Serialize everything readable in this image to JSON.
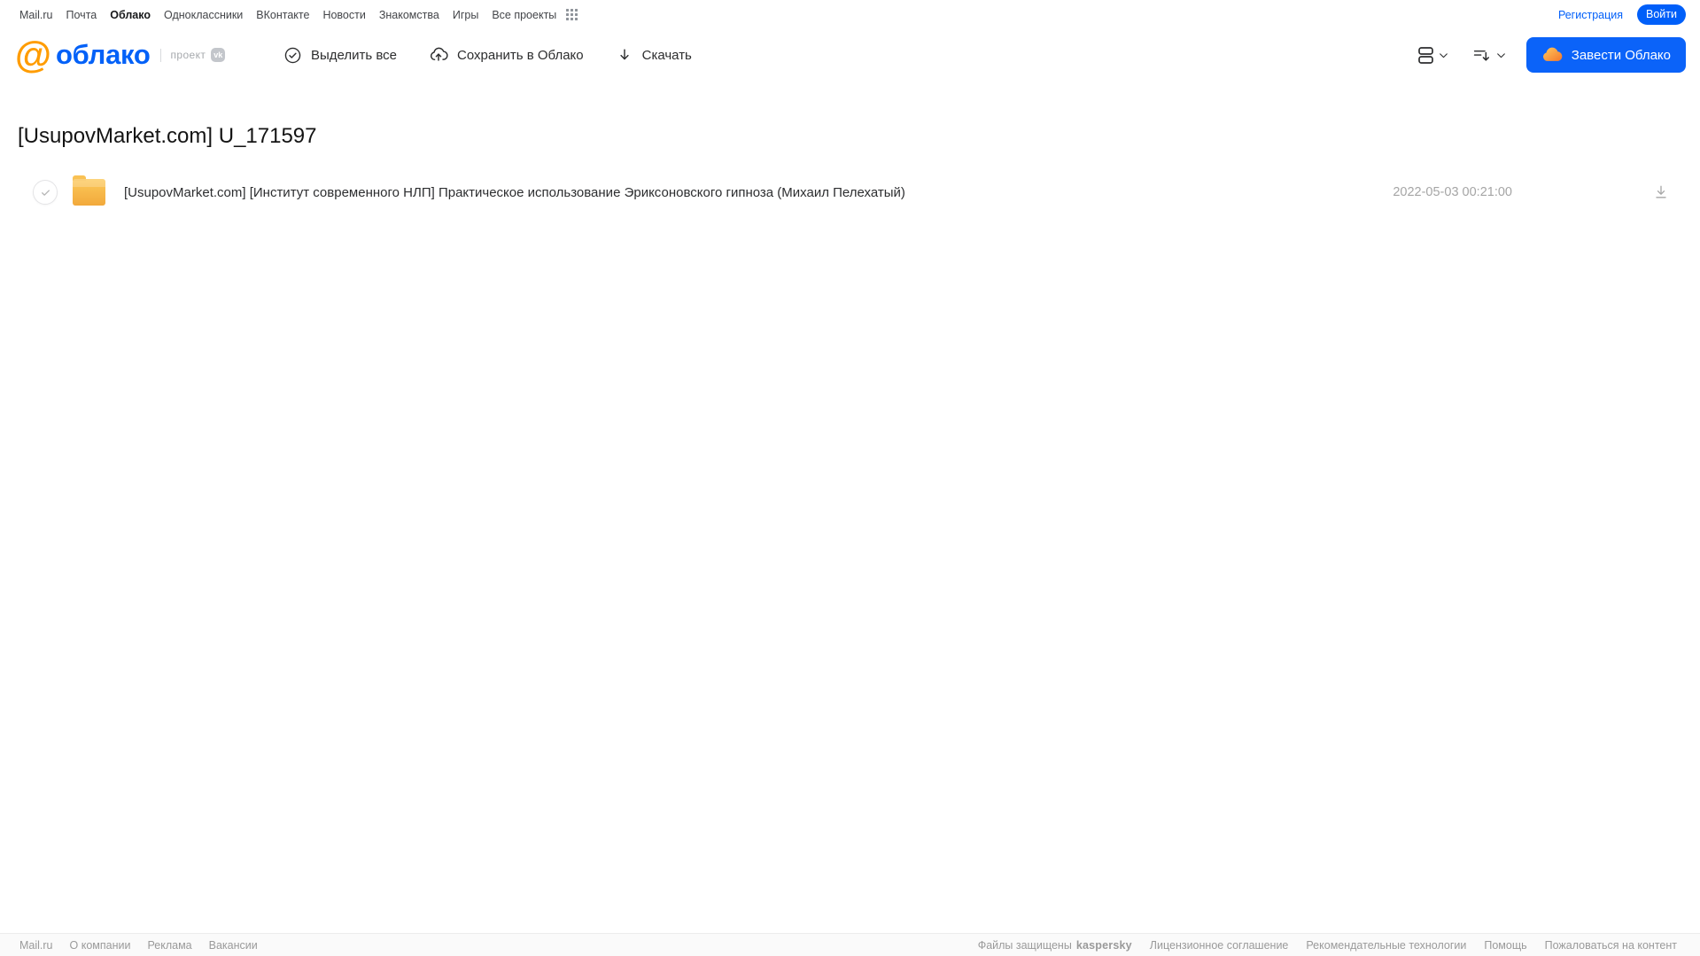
{
  "top_nav": {
    "items": [
      {
        "label": "Mail.ru"
      },
      {
        "label": "Почта"
      },
      {
        "label": "Облако"
      },
      {
        "label": "Одноклассники"
      },
      {
        "label": "ВКонтакте"
      },
      {
        "label": "Новости"
      },
      {
        "label": "Знакомства"
      },
      {
        "label": "Игры"
      },
      {
        "label": "Все проекты"
      }
    ],
    "registration_label": "Регистрация",
    "login_label": "Войти"
  },
  "header": {
    "logo": {
      "at_symbol": "@",
      "product": "облако",
      "project_label": "проект",
      "vk_badge": "vk"
    },
    "toolbar": {
      "select_all": "Выделить все",
      "save_to_cloud": "Сохранить в Облако",
      "download": "Скачать"
    },
    "get_cloud_button": "Завести Облако"
  },
  "page": {
    "title": "[UsupovMarket.com] U_171597"
  },
  "files": [
    {
      "type": "folder",
      "name": "[UsupovMarket.com] [Институт современного НЛП] Практическое использование Эриксоновского гипноза (Михаил Пелехатый)",
      "modified": "2022-05-03 00:21:00"
    }
  ],
  "footer": {
    "left_links": [
      "Mail.ru",
      "О компании",
      "Реклама",
      "Вакансии"
    ],
    "protected_by": "Файлы защищены",
    "kaspersky_label": "kaspersky",
    "right_links": [
      "Лицензионное соглашение",
      "Рекомендательные технологии",
      "Помощь",
      "Пожаловаться на контент"
    ]
  },
  "icons": [
    "apps-grid-icon",
    "check-circle-icon",
    "cloud-upload-icon",
    "download-icon",
    "view-mode-icon",
    "sort-icon",
    "chevron-down-icon",
    "cloud-icon",
    "folder-icon",
    "checkbox-check-icon",
    "download-arrow-icon",
    "vk-badge-icon",
    "at-logo-icon"
  ],
  "colors": {
    "brand_blue": "#005FF9",
    "logo_orange": "#FF9C00",
    "folder_yellow": "#F7B24A",
    "kaspersky_green": "#00A88E",
    "text_dark": "#2C2D2E",
    "text_gray": "#9A9A9A"
  }
}
